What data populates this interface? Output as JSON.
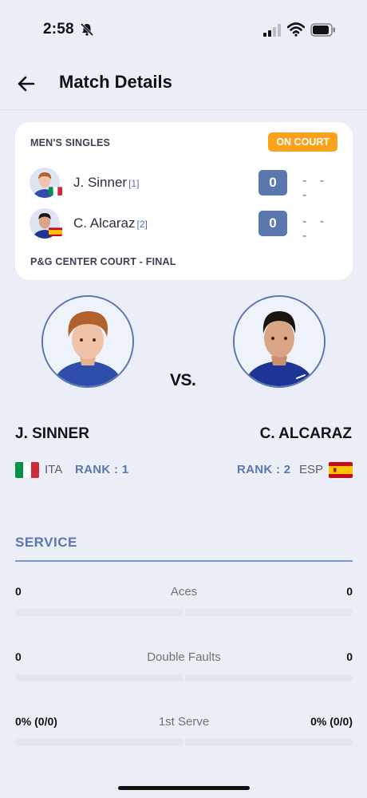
{
  "status_bar": {
    "time": "2:58"
  },
  "header": {
    "title": "Match Details"
  },
  "match": {
    "event": "MEN'S SINGLES",
    "status": "ON COURT",
    "venue": "P&G CENTER COURT - FINAL",
    "players": [
      {
        "name": "J. Sinner",
        "seed": "[1]",
        "score": "0",
        "sets": "- - -"
      },
      {
        "name": "C. Alcaraz",
        "seed": "[2]",
        "score": "0",
        "sets": "- - -"
      }
    ]
  },
  "versus": {
    "vs_label": "VS.",
    "left": {
      "name": "J. SINNER",
      "country": "ITA",
      "rank": "RANK : 1"
    },
    "right": {
      "name": "C. ALCARAZ",
      "country": "ESP",
      "rank": "RANK : 2"
    }
  },
  "service": {
    "title": "SERVICE",
    "stats": [
      {
        "label": "Aces",
        "left": "0",
        "right": "0",
        "left_fraction": 0,
        "right_fraction": 0
      },
      {
        "label": "Double Faults",
        "left": "0",
        "right": "0",
        "left_fraction": 0,
        "right_fraction": 0
      },
      {
        "label": "1st Serve",
        "left": "0% (0/0)",
        "right": "0% (0/0)",
        "left_fraction": 0,
        "right_fraction": 0
      }
    ]
  },
  "colors": {
    "accent": "#5b77af",
    "badge": "#fba11c",
    "background": "#ebeef7"
  }
}
